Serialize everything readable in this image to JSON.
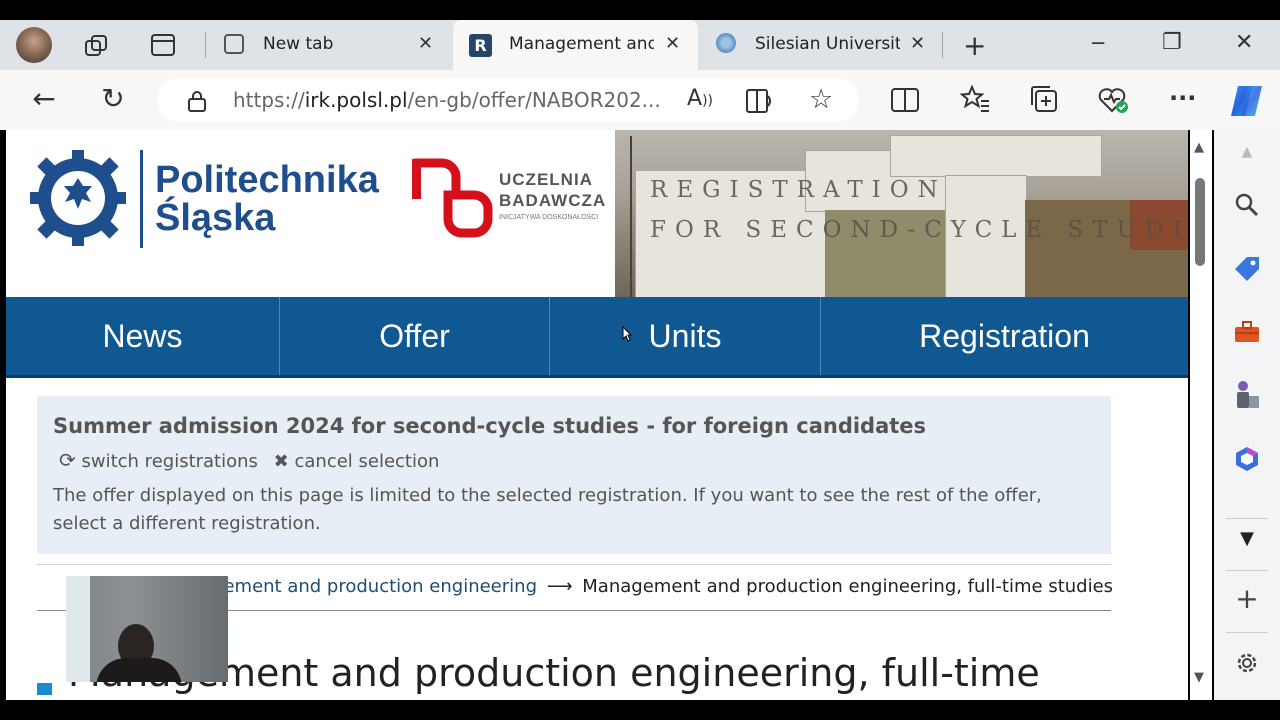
{
  "tabs": [
    {
      "label": "New tab",
      "active": false
    },
    {
      "label": "Management and production engineering",
      "active": true,
      "favicon": "R"
    },
    {
      "label": "Silesian University of Technology",
      "active": false
    }
  ],
  "address_bar": {
    "url_prefix": "https://",
    "url_host": "irk.polsl.pl",
    "url_path": "/en-gb/offer/NABOR202..."
  },
  "icons": {
    "profile": "avatar",
    "workspaces": "workspaces-icon",
    "tab_actions": "tab-actions-icon",
    "new_tab": "+",
    "minimize": "─",
    "restore": "❐",
    "close": "✕",
    "back": "←",
    "refresh": "↻",
    "read_aloud": "A",
    "favorite": "☆",
    "more": "···"
  },
  "logo": {
    "name_line1": "Politechnika",
    "name_line2": "Śląska",
    "badge_line1": "UCZELNIA",
    "badge_line2": "BADAWCZA",
    "badge_line3": "INICJATYWA DOSKONAŁOŚCI"
  },
  "banner": {
    "line1": "REGISTRATION",
    "line2": "FOR SECOND-CYCLE STUDIES"
  },
  "nav": {
    "items": [
      "News",
      "Offer",
      "Units",
      "Registration"
    ]
  },
  "notice": {
    "title": "Summer admission 2024 for second-cycle studies - for foreign candidates",
    "switch_label": "switch registrations",
    "cancel_label": "cancel selection",
    "text": "The offer displayed on this page is limited to the selected registration. If you want to see the rest of the offer, select a different registration."
  },
  "breadcrumb": {
    "link": "agement and production engineering",
    "arrow": "⟶",
    "current": "Management and production engineering, full-time studies"
  },
  "heading": "Management and production engineering, full-time",
  "colors": {
    "nav_bg": "#0f5892",
    "brand_blue": "#1f4e8c",
    "brand_red": "#d4111b",
    "notice_bg": "#e7eef5"
  }
}
